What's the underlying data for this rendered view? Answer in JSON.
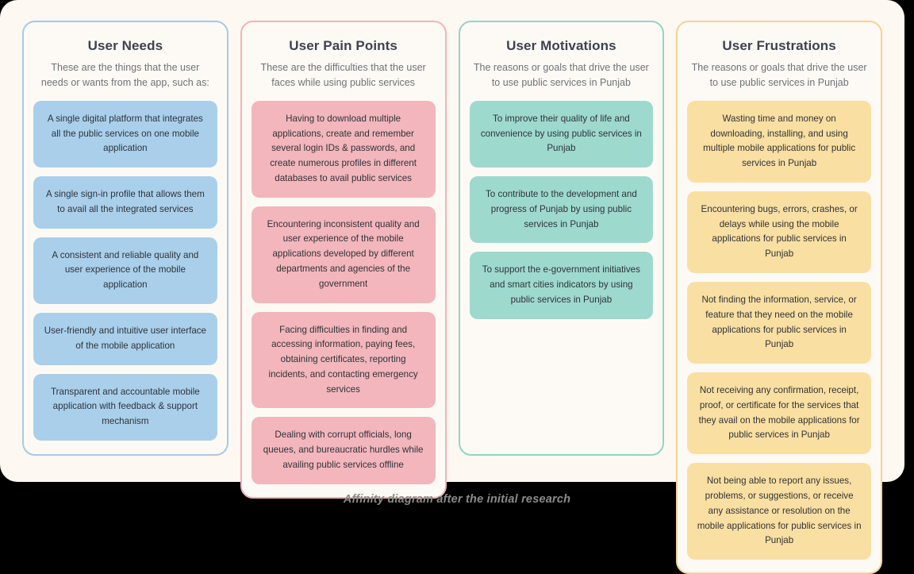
{
  "caption": "Affinity diagram after the initial research",
  "colors": {
    "page_background": "#000000",
    "panel_background": "#fdf8f1",
    "column_background": "#fdfaf5",
    "title_text": "#3e4250",
    "description_text": "#6f7278",
    "card_text": "#2f3339",
    "caption_text": "#8a8a8a",
    "blue_border": "#a4cbe8",
    "blue_card": "#a9cfeb",
    "pink_border": "#f3b2ba",
    "pink_card": "#f2b6bc",
    "teal_border": "#93d4c9",
    "teal_card": "#9ed9ce",
    "yellow_border": "#f4d493",
    "yellow_card": "#fadfa2"
  },
  "columns": [
    {
      "title": "User Needs",
      "description": "These are the things that the user needs or wants from the app, such as:",
      "accent": "blue",
      "cards": [
        "A single digital platform that integrates all the public services on one mobile application",
        "A single sign-in profile that allows them to avail all the integrated services",
        "A consistent and reliable quality and user experience of the mobile application",
        "User-friendly and intuitive user interface of the mobile application",
        "Transparent and accountable mobile application with feedback & support mechanism"
      ]
    },
    {
      "title": "User Pain Points",
      "description": "These are the difficulties that the user faces while using public services",
      "accent": "pink",
      "cards": [
        "Having to download multiple applications, create and remember several login IDs & passwords, and create numerous profiles in different databases to avail public services",
        "Encountering inconsistent quality and user experience of the mobile applications developed by different departments and agencies of the government",
        "Facing difficulties in finding and accessing information, paying fees, obtaining certificates, reporting incidents, and contacting emergency services",
        "Dealing with corrupt officials, long queues, and bureaucratic hurdles while availing public services offline"
      ]
    },
    {
      "title": "User Motivations",
      "description": "The reasons or goals that drive the user to use public services in Punjab",
      "accent": "teal",
      "cards": [
        "To improve their quality of life and convenience by using public services in Punjab",
        "To contribute to the development and progress of Punjab by using public services in Punjab",
        "To support the e-government initiatives and smart cities indicators by using public services in Punjab"
      ]
    },
    {
      "title": "User Frustrations",
      "description": "The reasons or goals that drive the user to use public services in Punjab",
      "accent": "yellow",
      "cards": [
        "Wasting time and money on downloading, installing, and using multiple mobile applications for public services in Punjab",
        "Encountering bugs, errors, crashes, or delays while using the mobile applications for public services in Punjab",
        "Not finding the information, service, or feature that they need on the mobile applications for public services in Punjab",
        "Not receiving any confirmation, receipt, proof, or certificate for the services that they avail on the mobile applications for public services in Punjab",
        "Not being able to report any issues, problems, or suggestions, or receive any assistance or resolution on the mobile applications for public services in Punjab"
      ]
    }
  ]
}
